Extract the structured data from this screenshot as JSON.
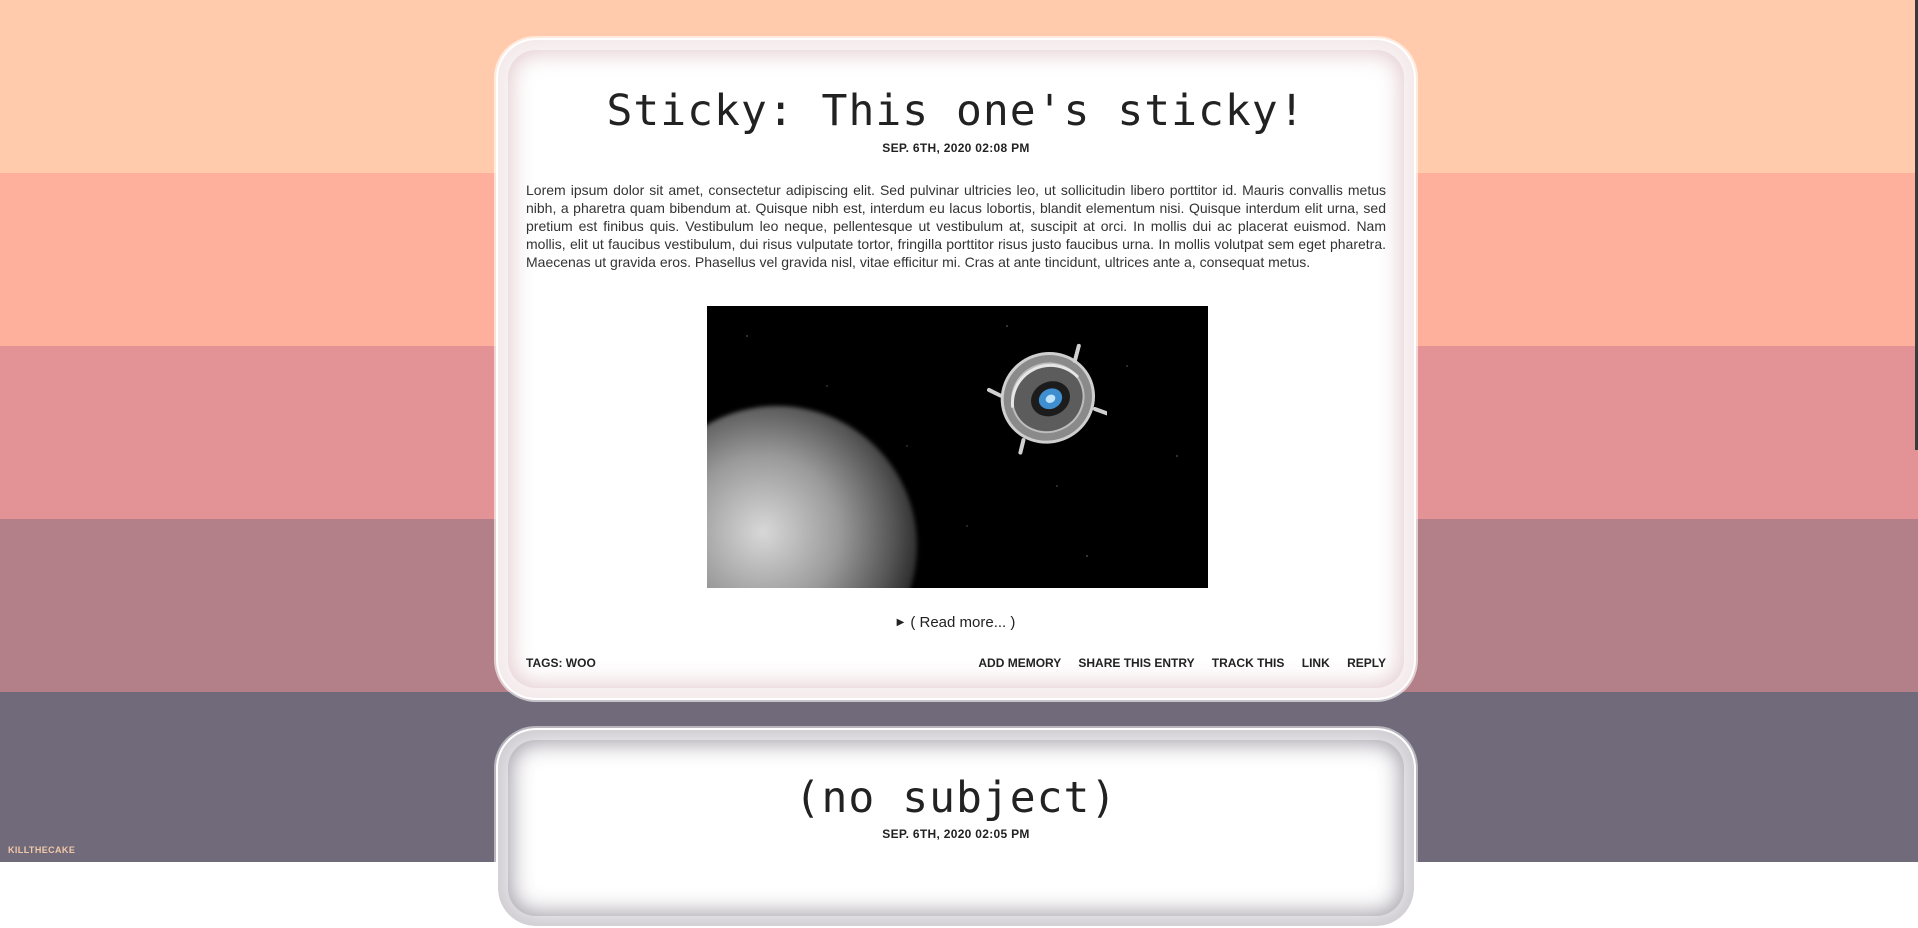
{
  "entries": [
    {
      "title": "Sticky: This one's sticky!",
      "date": "SEP. 6TH, 2020 02:08 PM",
      "body": "Lorem ipsum dolor sit amet, consectetur adipiscing elit. Sed pulvinar ultricies leo, ut sollicitudin libero porttitor id. Mauris convallis metus nibh, a pharetra quam bibendum at. Quisque nibh est, interdum eu lacus lobortis, blandit elementum nisi. Quisque interdum elit urna, sed pretium est finibus quis. Vestibulum leo neque, pellentesque ut vestibulum at, suscipit at orci. In mollis dui ac placerat euismod. Nam mollis, elit ut faucibus vestibulum, dui risus vulputate tortor, fringilla porttitor risus justo faucibus urna. In mollis volutpat sem eget pharetra. Maecenas ut gravida eros. Phasellus vel gravida nisl, vitae efficitur mi. Cras at ante tincidunt, ultrices ante a, consequat metus.",
      "read_more": "( Read more... )",
      "tags_label": "TAGS:",
      "tags_value": "WOO",
      "actions": [
        "ADD MEMORY",
        "SHARE THIS ENTRY",
        "TRACK THIS",
        "LINK",
        "REPLY"
      ]
    },
    {
      "title": "(no subject)",
      "date": "SEP. 6TH, 2020 02:05 PM"
    }
  ],
  "corner_label": "KILLTHECAKE"
}
